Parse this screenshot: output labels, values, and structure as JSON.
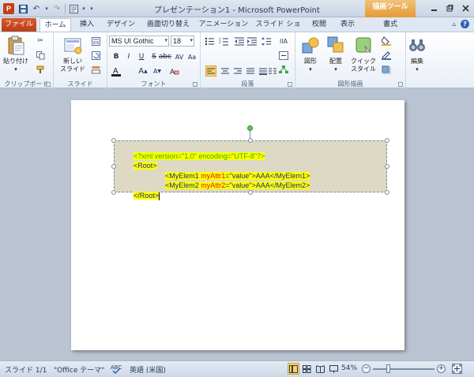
{
  "window": {
    "title": "プレゼンテーション1 - Microsoft PowerPoint",
    "context_tool": "描画ツール"
  },
  "tabs": [
    {
      "label": "ファイル"
    },
    {
      "label": "ホーム"
    },
    {
      "label": "挿入"
    },
    {
      "label": "デザイン"
    },
    {
      "label": "画面切り替え"
    },
    {
      "label": "アニメーション"
    },
    {
      "label": "スライド ショー"
    },
    {
      "label": "校閲"
    },
    {
      "label": "表示"
    },
    {
      "label": "書式"
    }
  ],
  "ribbon": {
    "clipboard": {
      "paste_label": "貼り付け",
      "group_label": "クリップボード"
    },
    "slides": {
      "new_slide_label": "新しい\nスライド",
      "group_label": "スライド"
    },
    "font": {
      "font_name": "MS UI Gothic",
      "font_size": "18",
      "group_label": "フォント"
    },
    "paragraph": {
      "group_label": "段落"
    },
    "drawing": {
      "shape_label": "図形",
      "arrange_label": "配置",
      "quick_style_label": "クイック\nスタイル",
      "group_label": "図形描画"
    },
    "editing": {
      "edit_label": "編集"
    }
  },
  "slide": {
    "lines": [
      {
        "parts": [
          {
            "t": "<?xml version=\"1.0\" encoding=\"UTF-8\"?>",
            "c": "green"
          }
        ]
      },
      {
        "parts": [
          {
            "t": "<Root>",
            "c": "dark"
          }
        ]
      },
      {
        "parts": [
          {
            "t": "<MyElem1 ",
            "c": "dark"
          },
          {
            "t": "myAttr1",
            "c": "red"
          },
          {
            "t": "=\"value\">AAA</MyElem1>",
            "c": "dark"
          }
        ]
      },
      {
        "parts": [
          {
            "t": "<MyElem2 ",
            "c": "dark"
          },
          {
            "t": "myAttr2",
            "c": "red"
          },
          {
            "t": "=\"value\">AAA</MyElem2>",
            "c": "dark"
          }
        ]
      },
      {
        "parts": [
          {
            "t": "</Root>",
            "c": "dark"
          }
        ]
      }
    ]
  },
  "status": {
    "slide_info": "スライド 1/1",
    "theme": "\"Office テーマ\"",
    "language": "英語 (米国)",
    "zoom": "54%"
  },
  "colors": {
    "file_tab": "#c4491f",
    "textbox_fill": "#ddd9c4",
    "highlight": "#ffff00",
    "xml_decl": "#27b01a",
    "attr": "#e01919"
  }
}
